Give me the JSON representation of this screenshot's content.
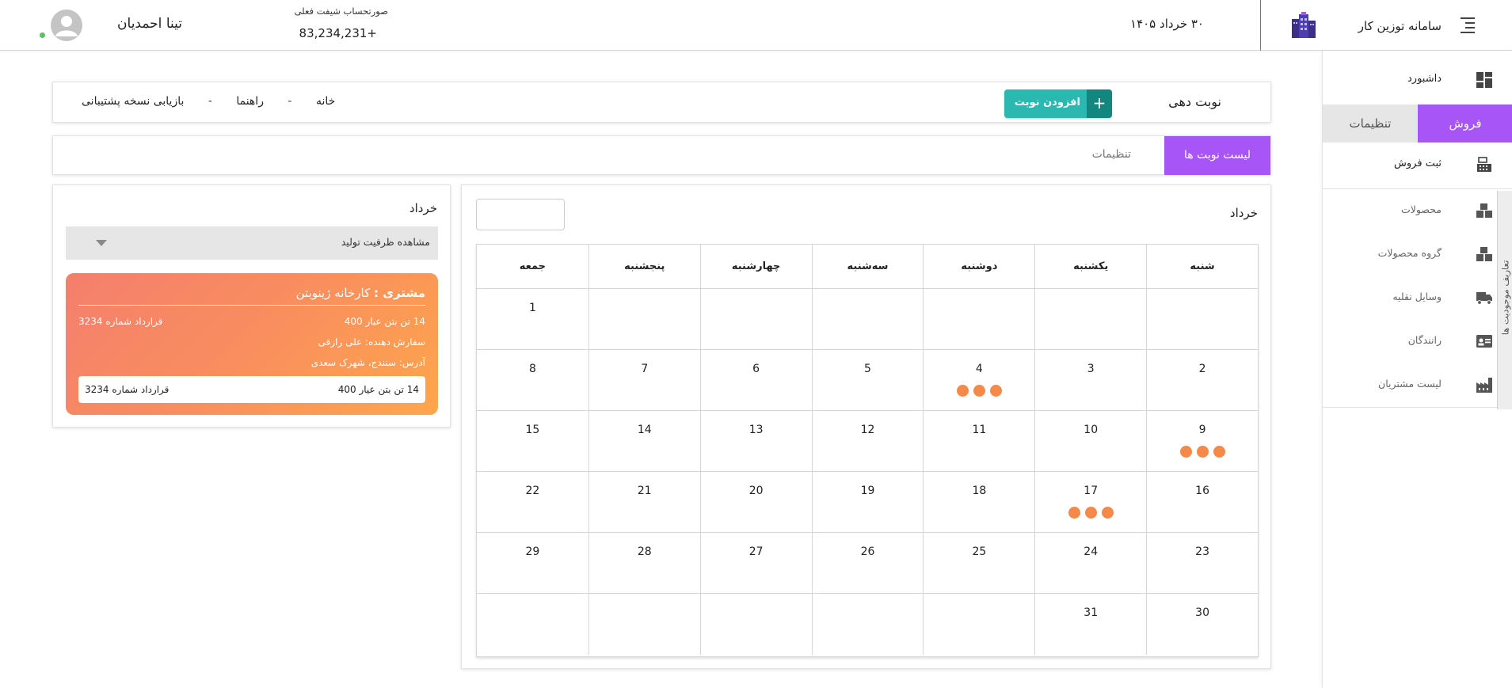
{
  "header": {
    "app_title": "سامانه توزین کار",
    "current_date": "۳۰ خرداد ۱۴۰۵",
    "shift_label": "صورتحساب شیفت فعلی",
    "shift_amount": "83,234,231+",
    "user_name": "تینا احمدیان",
    "online_color": "#5ac35a"
  },
  "sidebar": {
    "dashboard_label": "داشبورد",
    "tabs": [
      {
        "label": "فروش",
        "active": true
      },
      {
        "label": "تنظیمات",
        "active": false
      }
    ],
    "register_sale_label": "ثبت فروش",
    "sub_items": [
      {
        "label": "محصولات",
        "icon": "boxes-icon"
      },
      {
        "label": "گروه محصولات",
        "icon": "boxes-group-icon"
      },
      {
        "label": "وسایل نقلیه",
        "icon": "truck-icon"
      },
      {
        "label": "رانندگان",
        "icon": "id-card-icon"
      },
      {
        "label": "لیست مشتریان",
        "icon": "factory-icon"
      }
    ],
    "vertical_tab_label": "تعاریف موجودیت ها",
    "accent_color": "#a855f7"
  },
  "top_bar": {
    "page_title": "نوبت دهی",
    "add_button_label": "افزودن نوبت",
    "breadcrumb": {
      "home": "خانه",
      "help": "راهنما",
      "backup": "بازیابی نسخه پشتیبانی",
      "separator": "-"
    }
  },
  "tab_bar": {
    "active_tab": "لیست نوبت ها",
    "inactive_tab": "تنظیمات"
  },
  "calendar": {
    "month": "خرداد",
    "weekdays": [
      "شنبه",
      "یکشنبه",
      "دوشنبه",
      "سه‌شنبه",
      "چهارشنبه",
      "پنجشنبه",
      "جمعه"
    ],
    "weeks": [
      [
        {
          "d": ""
        },
        {
          "d": ""
        },
        {
          "d": ""
        },
        {
          "d": ""
        },
        {
          "d": ""
        },
        {
          "d": ""
        },
        {
          "d": "1"
        }
      ],
      [
        {
          "d": "2"
        },
        {
          "d": "3"
        },
        {
          "d": "4",
          "dots": 3
        },
        {
          "d": "5"
        },
        {
          "d": "6"
        },
        {
          "d": "7"
        },
        {
          "d": "8"
        }
      ],
      [
        {
          "d": "9",
          "dots": 3
        },
        {
          "d": "10"
        },
        {
          "d": "11"
        },
        {
          "d": "12"
        },
        {
          "d": "13"
        },
        {
          "d": "14"
        },
        {
          "d": "15"
        }
      ],
      [
        {
          "d": "16"
        },
        {
          "d": "17",
          "dots": 3
        },
        {
          "d": "18"
        },
        {
          "d": "19"
        },
        {
          "d": "20"
        },
        {
          "d": "21"
        },
        {
          "d": "22"
        }
      ],
      [
        {
          "d": "23"
        },
        {
          "d": "24"
        },
        {
          "d": "25"
        },
        {
          "d": "26"
        },
        {
          "d": "27"
        },
        {
          "d": "28"
        },
        {
          "d": "29"
        }
      ],
      [
        {
          "d": "30"
        },
        {
          "d": "31"
        },
        {
          "d": ""
        },
        {
          "d": ""
        },
        {
          "d": ""
        },
        {
          "d": ""
        },
        {
          "d": ""
        }
      ]
    ],
    "dot_color": "#f5894a"
  },
  "panel": {
    "month": "خرداد",
    "capacity_label": "مشاهده ظرفیت تولید",
    "order": {
      "customer_label": "مشتری :",
      "customer_name": "کارخانه ژینوبتن",
      "product": "14 تن بتن عیار 400",
      "contract": "قرارداد شماره 3234",
      "orderer": "سفارش دهنده: علی رازقی",
      "address": "آدرس: سنندج، شهرک سعدی",
      "inner_product": "14 تن بتن عیار 400",
      "inner_contract": "قرارداد شماره 3234"
    }
  }
}
